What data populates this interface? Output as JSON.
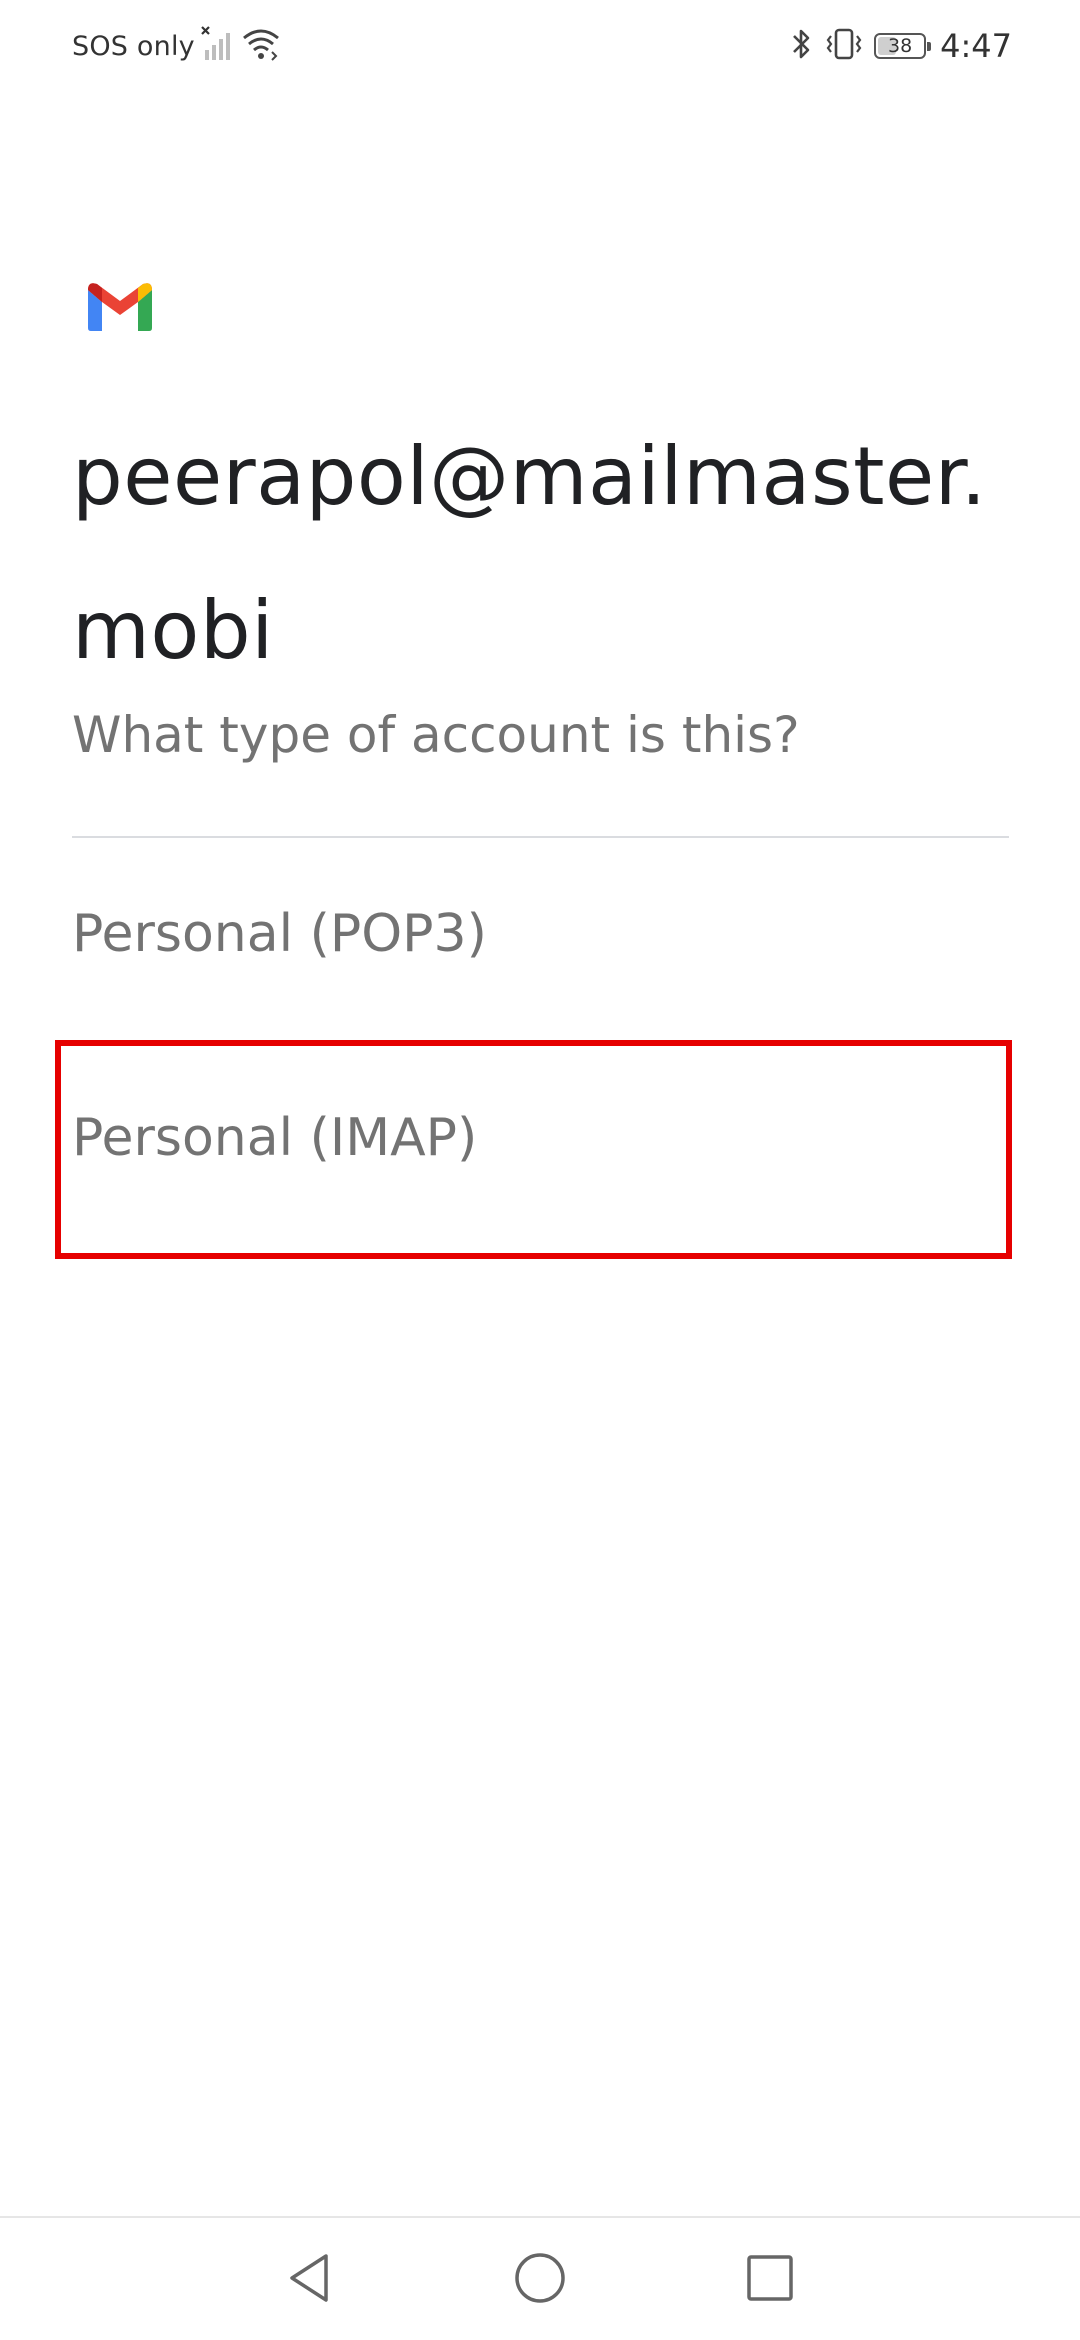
{
  "status_bar": {
    "carrier": "SOS only",
    "battery_level": "38",
    "battery_fraction": 0.38,
    "time": "4:47",
    "icons": [
      "signal-off-icon",
      "wifi-icon",
      "bluetooth-icon",
      "vibrate-icon",
      "battery-icon"
    ]
  },
  "app": {
    "logo": "gmail-logo",
    "account_email": "peerapol@mailmaster.mobi",
    "prompt": "What type of account is this?"
  },
  "options": [
    {
      "label": "Personal (POP3)"
    },
    {
      "label": "Personal (IMAP)",
      "highlighted": true
    }
  ],
  "colors": {
    "highlight": "#e60000",
    "text_primary": "#202124",
    "text_secondary": "#737373",
    "divider": "#dadce0"
  },
  "nav_bar": {
    "buttons": [
      "back-icon",
      "home-icon",
      "recents-icon"
    ]
  }
}
